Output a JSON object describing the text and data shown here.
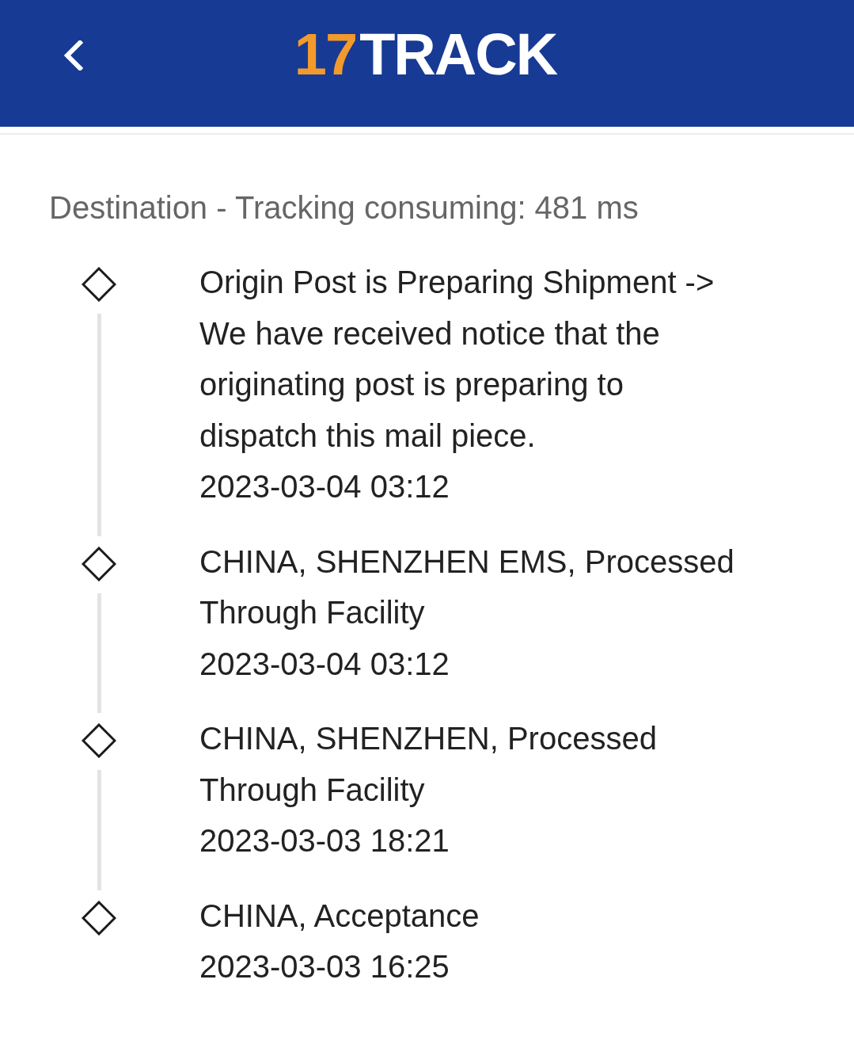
{
  "header": {
    "logo": {
      "accent": "17",
      "text": "TRACK"
    }
  },
  "heading": "Destination - Tracking consuming: 481 ms",
  "events": [
    {
      "description": "Origin Post is Preparing Shipment -> We have received notice that the originating post is preparing to dispatch this mail piece.",
      "time": "2023-03-04 03:12"
    },
    {
      "description": "CHINA, SHENZHEN EMS, Processed Through Facility",
      "time": "2023-03-04 03:12"
    },
    {
      "description": "CHINA, SHENZHEN, Processed Through Facility",
      "time": "2023-03-03 18:21"
    },
    {
      "description": "CHINA, Acceptance",
      "time": "2023-03-03 16:25"
    }
  ]
}
